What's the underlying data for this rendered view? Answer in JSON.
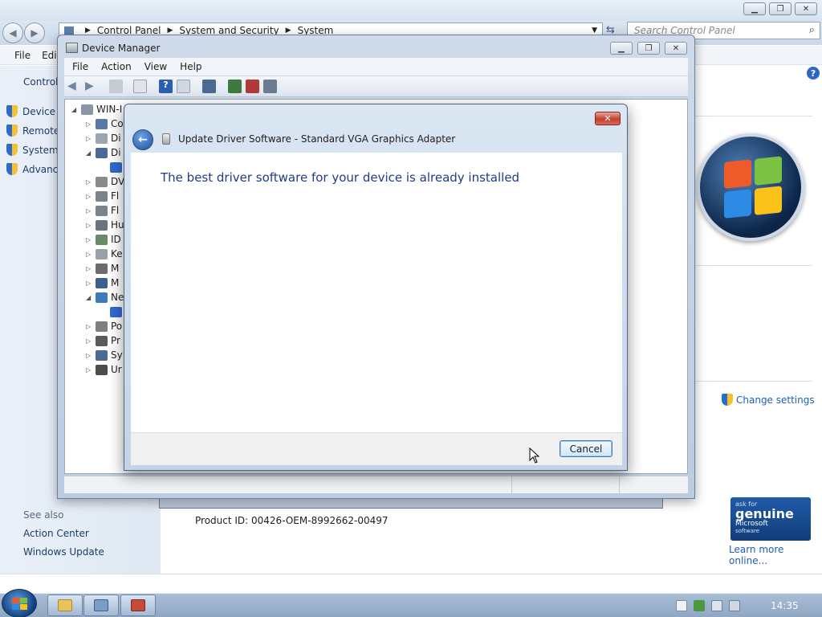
{
  "control_panel": {
    "breadcrumb": [
      "Control Panel",
      "System and Security",
      "System"
    ],
    "search_placeholder": "Search Control Panel",
    "menu": [
      "File",
      "Edit"
    ],
    "left_header": "Control",
    "left_items": [
      "Device M",
      "Remote",
      "System",
      "Advance"
    ],
    "see_also_label": "See also",
    "see_also_items": [
      "Action Center",
      "Windows Update"
    ],
    "change_settings": "Change settings",
    "product_id": "Product ID: 00426-OEM-8992662-00497",
    "genuine": {
      "line1": "ask for",
      "line2": "genuine",
      "line3": "Microsoft",
      "line4": "software"
    },
    "learn_more": "Learn more online..."
  },
  "device_manager": {
    "title": "Device Manager",
    "menu": [
      "File",
      "Action",
      "View",
      "Help"
    ],
    "tree_root": "WIN-I",
    "tree_items": [
      {
        "label": "Co",
        "expanded": false
      },
      {
        "label": "Di",
        "expanded": false
      },
      {
        "label": "Di",
        "expanded": true
      },
      {
        "label": "",
        "child": true
      },
      {
        "label": "DV",
        "expanded": false
      },
      {
        "label": "Fl",
        "expanded": false
      },
      {
        "label": "Fl",
        "expanded": false
      },
      {
        "label": "Hu",
        "expanded": false
      },
      {
        "label": "ID",
        "expanded": false
      },
      {
        "label": "Ke",
        "expanded": false
      },
      {
        "label": "M",
        "expanded": false
      },
      {
        "label": "M",
        "expanded": false
      },
      {
        "label": "Ne",
        "expanded": true
      },
      {
        "label": "",
        "child": true
      },
      {
        "label": "Po",
        "expanded": false
      },
      {
        "label": "Pr",
        "expanded": false
      },
      {
        "label": "Sy",
        "expanded": false
      },
      {
        "label": "Ur",
        "expanded": false
      }
    ]
  },
  "dialog": {
    "close_glyph": "✕",
    "back_glyph": "←",
    "title": "Update Driver Software - Standard VGA Graphics Adapter",
    "message": "The best driver software for your device is already installed",
    "cancel": "Cancel"
  },
  "taskbar": {
    "clock": "14:35"
  },
  "colors": {
    "link": "#1e5fb3",
    "dialog_message": "#1f3c88",
    "close_red": "#c4402f"
  }
}
